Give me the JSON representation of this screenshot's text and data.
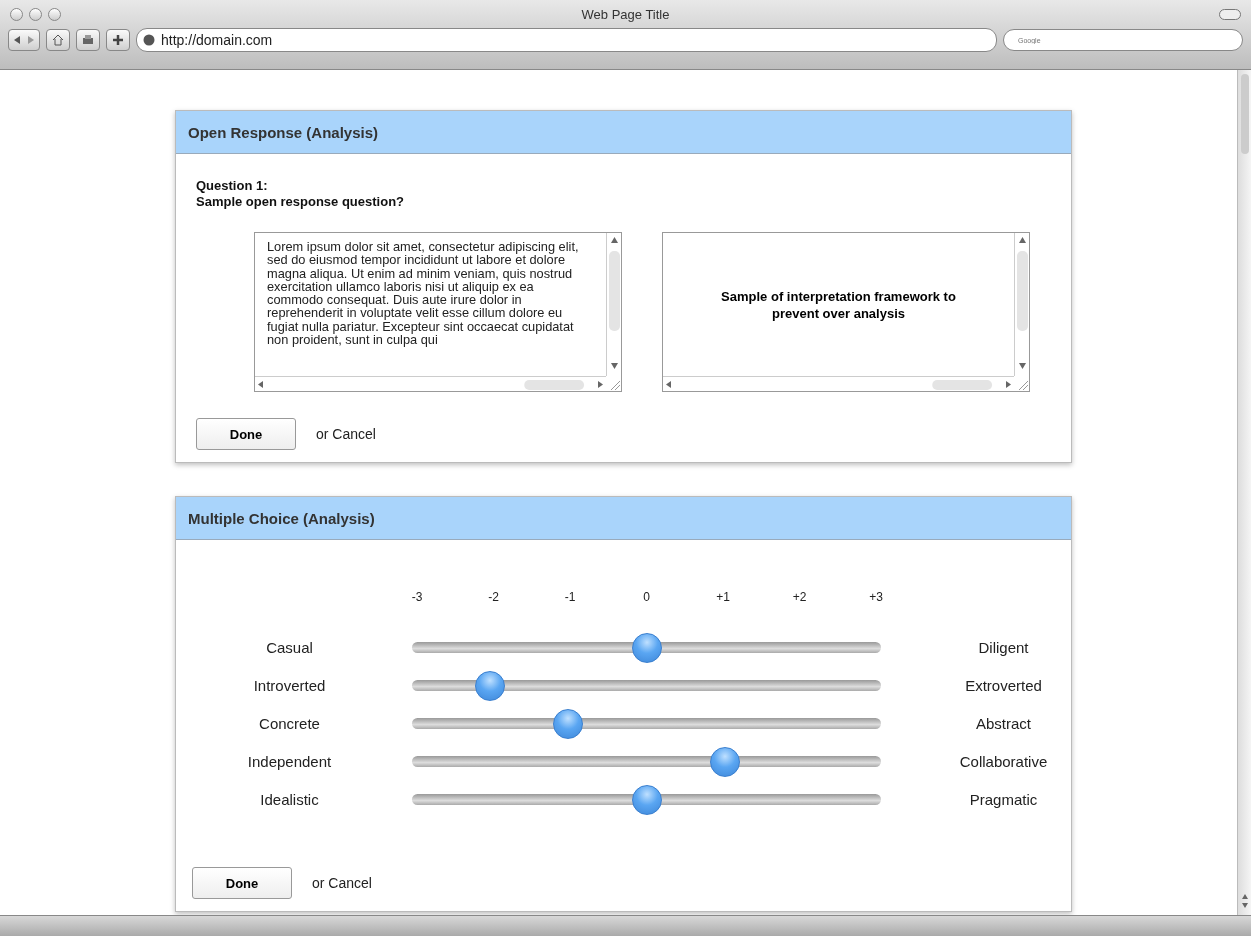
{
  "window": {
    "title": "Web Page Title",
    "url": "http://domain.com",
    "search_placeholder": "Google"
  },
  "open_response": {
    "title": "Open Response (Analysis)",
    "question_label": "Question 1:",
    "question": "Sample open response question?",
    "answer": "Lorem ipsum dolor sit amet, consectetur adipiscing elit, sed do eiusmod tempor incididunt ut labore et dolore magna aliqua. Ut enim ad minim veniam, quis nostrud exercitation ullamco laboris nisi ut aliquip ex ea commodo consequat. Duis aute irure dolor in reprehenderit in voluptate velit esse cillum dolore eu fugiat nulla pariatur. Excepteur sint occaecat cupidatat non proident, sunt in culpa qui",
    "framework": "Sample of interpretation framework to prevent over analysis",
    "done": "Done",
    "cancel": "or Cancel"
  },
  "multiple_choice": {
    "title": "Multiple Choice (Analysis)",
    "scale": [
      "-3",
      "-2",
      "-1",
      "0",
      "+1",
      "+2",
      "+3"
    ],
    "sliders": [
      {
        "left": "Casual",
        "right": "Diligent",
        "level": 0.5
      },
      {
        "left": "Introverted",
        "right": "Extroverted",
        "level": 0.167
      },
      {
        "left": "Concrete",
        "right": "Abstract",
        "level": 0.333
      },
      {
        "left": "Independent",
        "right": "Collaborative",
        "level": 0.667
      },
      {
        "left": "Idealistic",
        "right": "Pragmatic",
        "level": 0.5
      }
    ],
    "done": "Done",
    "cancel": "or Cancel"
  }
}
